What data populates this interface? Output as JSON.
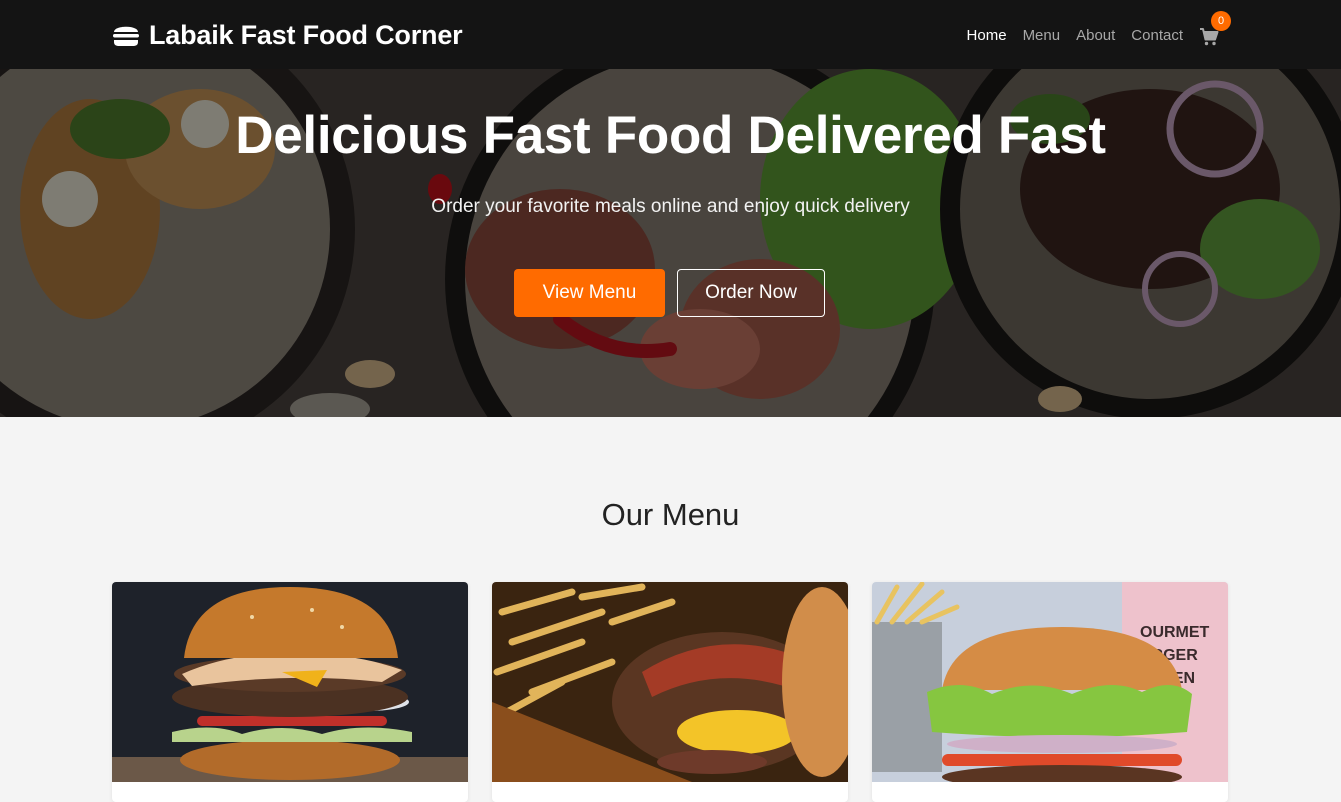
{
  "navbar": {
    "brand": "Labaik Fast Food Corner",
    "brand_icon": "burger-icon",
    "links": [
      {
        "label": "Home",
        "active": true
      },
      {
        "label": "Menu",
        "active": false
      },
      {
        "label": "About",
        "active": false
      },
      {
        "label": "Contact",
        "active": false
      }
    ],
    "cart": {
      "icon": "shopping-cart-icon",
      "count": "0"
    }
  },
  "hero": {
    "title": "Delicious Fast Food Delivered Fast",
    "subtitle": "Order your favorite meals online and enjoy quick delivery",
    "primary_button": "View Menu",
    "secondary_button": "Order Now"
  },
  "menu": {
    "title": "Our Menu",
    "items": [
      {
        "image": "burger-photo"
      },
      {
        "image": "bacon-burger-with-fries-photo"
      },
      {
        "image": "lettuce-burger-photo"
      }
    ]
  },
  "colors": {
    "accent": "#ff6b00",
    "navbar_bg": "#141414",
    "page_bg": "#f4f4f4"
  }
}
